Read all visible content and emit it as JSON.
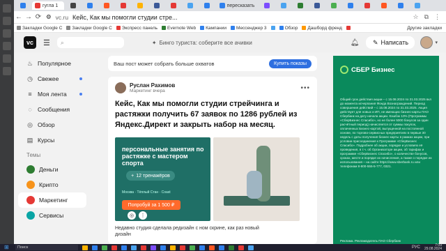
{
  "browser": {
    "tabs": [
      {
        "label": "",
        "color": "#2f80ed"
      },
      {
        "label": "гугла 1",
        "color": "#e53935",
        "active": true
      },
      {
        "label": "",
        "color": "#444444"
      },
      {
        "label": "",
        "color": "#2f80ed"
      },
      {
        "label": "",
        "color": "#ff5722"
      },
      {
        "label": "",
        "color": "#e53935"
      },
      {
        "label": "",
        "color": "#ffb300"
      },
      {
        "label": "",
        "color": "#3b5998"
      },
      {
        "label": "",
        "color": "#e53935"
      },
      {
        "label": "",
        "color": "#4aa3f0"
      },
      {
        "label": "",
        "color": "#2f80ed"
      },
      {
        "label": "пересказать",
        "color": "#2f80ed"
      },
      {
        "label": "",
        "color": "#7c4dff"
      },
      {
        "label": "",
        "color": "#4aa3f0"
      },
      {
        "label": "",
        "color": "#2e7d32"
      },
      {
        "label": "",
        "color": "#3b5998"
      },
      {
        "label": "",
        "color": "#4caf50"
      },
      {
        "label": "",
        "color": "#2f80ed"
      },
      {
        "label": "",
        "color": "#e53935"
      },
      {
        "label": "",
        "color": "#ff5722"
      },
      {
        "label": "",
        "color": "#2f80ed"
      },
      {
        "label": "",
        "color": "#4aa3f0"
      }
    ],
    "url_domain": "vc.ru",
    "page_title": "Кейс, Как мы помогли студии стре...",
    "bookmarks": [
      {
        "label": "Закладки Google C",
        "color": "#888888"
      },
      {
        "label": "Закладки Google C",
        "color": "#888888"
      },
      {
        "label": "Экспресс панель",
        "color": "#e53935"
      },
      {
        "label": "Evernote Web",
        "color": "#2e7d32"
      },
      {
        "label": "Кампании",
        "color": "#2f80ed"
      },
      {
        "label": "Мессенджер 3",
        "color": "#2f80ed"
      },
      {
        "label": "",
        "color": "#4aa3f0"
      },
      {
        "label": "Обзор",
        "color": "#2f80ed"
      },
      {
        "label": "Дашборд френд",
        "color": "#ff9800"
      },
      {
        "label": "",
        "color": "#e53935"
      }
    ],
    "bookmarks_other": "Другие закладки"
  },
  "vc": {
    "logo": "vc",
    "search_icon": "search-icon",
    "promo_text": "Бинго туриста: соберите все ачивки",
    "write_label": "Написать"
  },
  "sidebar": {
    "items": [
      {
        "label": "Популярное",
        "icon": "flame-icon",
        "dot": false
      },
      {
        "label": "Свежее",
        "icon": "clock-icon",
        "dot": true
      },
      {
        "label": "Моя лента",
        "icon": "feed-icon",
        "dot": true
      },
      {
        "label": "Сообщения",
        "icon": "chat-icon",
        "dot": false
      },
      {
        "label": "Обзор",
        "icon": "compass-icon",
        "dot": false
      },
      {
        "label": "Курсы",
        "icon": "book-icon",
        "dot": false
      }
    ],
    "themes_header": "Темы",
    "themes": [
      {
        "label": "Деньги",
        "color": "#2e7d32"
      },
      {
        "label": "Крипто",
        "color": "#f7931a"
      },
      {
        "label": "Маркетинг",
        "color": "#e53935",
        "active": true
      },
      {
        "label": "Сервисы",
        "color": "#0aa5a5"
      }
    ]
  },
  "reach": {
    "text": "Ваш пост может собрать больше охватов",
    "button": "Купить показы"
  },
  "post": {
    "author": "Руслан Рахимов",
    "author_sub": "Маркетинг  вчера",
    "title": "Кейс, Как мы помогли студии стрейчинга и растяжки получить 67 заявок по 1286 рублей из Яндекс.Директ и закрыть набор на месяц.",
    "img_headline": "персональные занятия по растяжке с мастером спорта",
    "img_pill": "12 тренажёров",
    "img_small": "Москва · Тёплый Стан · Coast",
    "img_cta": "Попробуй за 1 500 ₽",
    "caption": "Недавно студия сделала редизайн с",
    "caption2": "ном скрине, как раз новый",
    "caption3": "дизайн"
  },
  "ad": {
    "brand": "СБЕР Бизнес",
    "text": "Общий срок действия акции – с 15.08.2024 по 31.03.2025 вкл до момента исчерпания Фонда Вознаграждений. Период совершения действий – с 15.08.2024 по 31.03.2025. Акция действует для новых и ИП, не имеющих бизнес-карты ПАО Сбербанк на дату начала акции. Кэшбэк 10% (Программы «СберБизнес Спасибо», но не более 5000 бонусов за один расчётный период) начисляется от суммы покупок, оплаченных Бизнес-картой, выпущенной на постоянной основе, по торгово-сервисных предприятиях в первые 30 недель с даты получения бизнес-карты в рамках акции, при условии присоединения к Программе «СберБизнес Спасибо». Подробнее об акции, порядке и условиях её проведения, в т.ч. об Организаторе акции, об тарифах и программе «СберБизнес Спасибо», о количестве бонусов, сроках, месте и порядке их начисления, а также о порядке их использования – на сайте https://www.sberbank.ru или телефонам 8-800-555-5-777, 0321.",
    "bottom": "Реклама. Рекламодатель ПАО Сбербанк"
  },
  "taskbar": {
    "search": "Поиск",
    "apps": [
      "#ffb300",
      "#2f80ed",
      "#4caf50",
      "#e53935",
      "#2f80ed",
      "#4aa3f0",
      "#e53935",
      "#7c4dff",
      "#2f80ed",
      "#ffb300",
      "#e53935",
      "#4caf50",
      "#2f80ed",
      "#ff5722",
      "#2f80ed",
      "#2e7d32",
      "#e53935",
      "#4aa3f0"
    ],
    "lang": "РУС",
    "time": "7:09",
    "date": "29.08.2024"
  }
}
